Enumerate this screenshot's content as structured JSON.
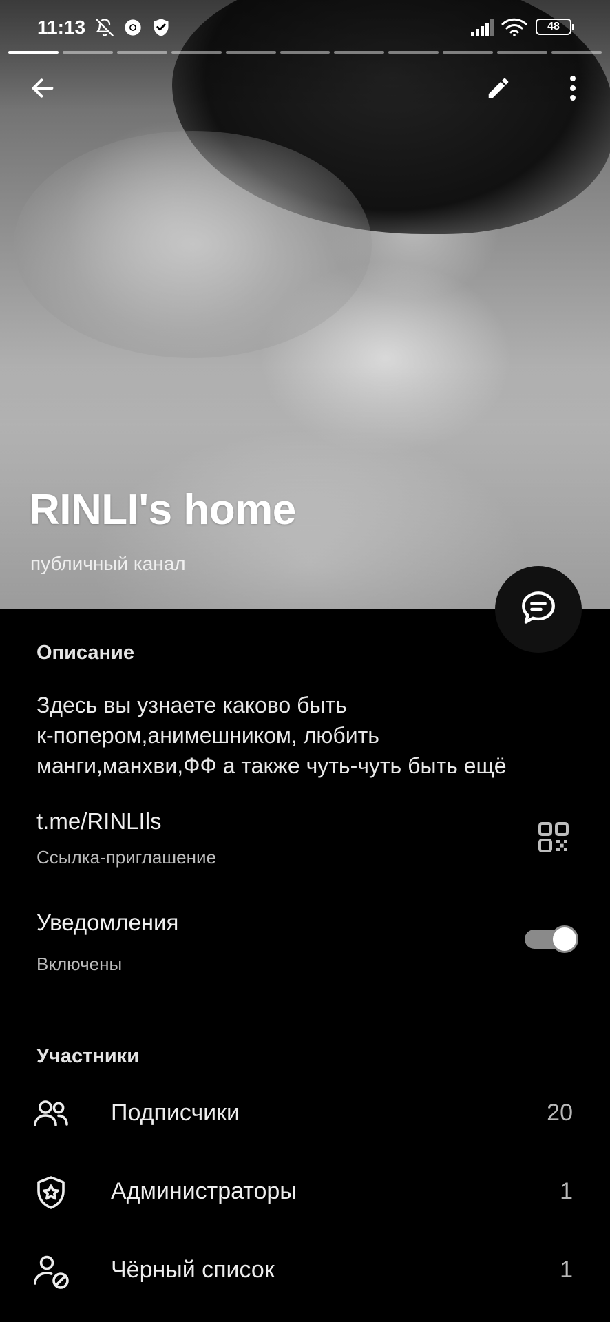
{
  "status_bar": {
    "time": "11:13",
    "battery": "48",
    "icons": [
      "bell-off-icon",
      "chrome-icon",
      "vpn-shield-icon",
      "signal-icon",
      "wifi-icon",
      "battery-icon"
    ]
  },
  "story": {
    "segments": 11,
    "active_segment": 1
  },
  "header": {
    "back_icon": "arrow-left-icon",
    "edit_icon": "pencil-icon",
    "menu_icon": "more-vertical-icon",
    "title": "RINLI's home",
    "subtitle": "публичный канал"
  },
  "fab": {
    "icon": "chat-bubble-icon"
  },
  "description": {
    "header": "Описание",
    "text": "Здесь вы узнаете каково быть\nк-попером,анимешником, любить\nманги,манхви,ФФ а также чуть-чуть быть ещё"
  },
  "invite": {
    "link": "t.me/RINLIls",
    "label": "Ссылка-приглашение",
    "qr_icon": "qr-code-icon"
  },
  "notifications": {
    "title": "Уведомления",
    "state": "Включены",
    "enabled": true
  },
  "members": {
    "header": "Участники",
    "items": [
      {
        "icon": "users-icon",
        "label": "Подписчики",
        "count": "20"
      },
      {
        "icon": "admin-shield-star-icon",
        "label": "Администраторы",
        "count": "1"
      },
      {
        "icon": "user-blocked-icon",
        "label": "Чёрный список",
        "count": "1"
      }
    ]
  },
  "colors": {
    "background": "#000000",
    "text_primary": "#ededed",
    "text_secondary": "#bdbdbd",
    "toggle_track": "#8a8a8a"
  }
}
